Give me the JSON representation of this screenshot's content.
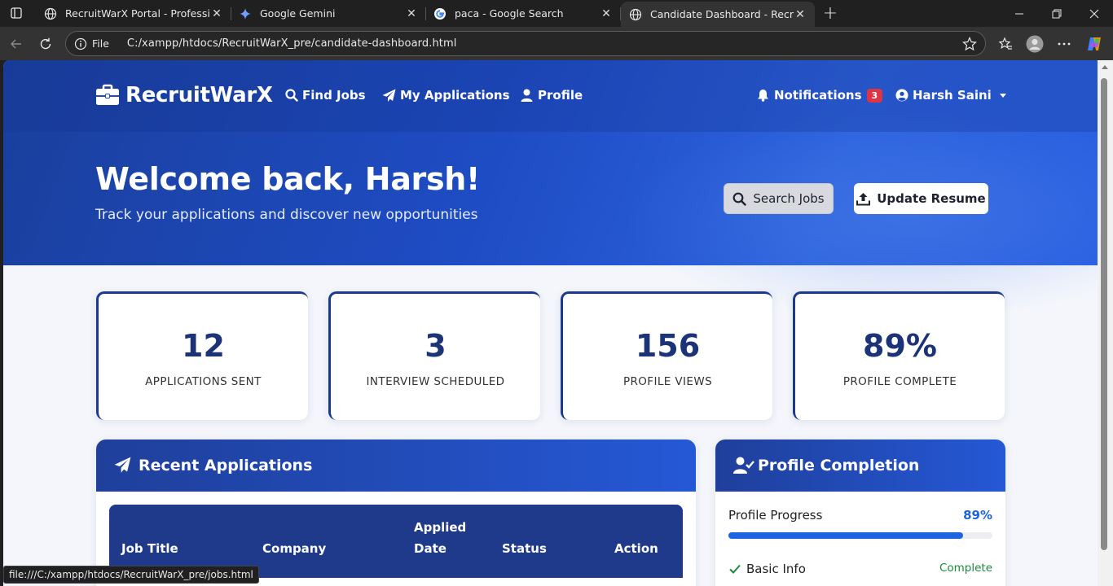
{
  "browser": {
    "tabs": [
      {
        "title": "RecruitWarX Portal - Professional",
        "icon": "globe-icon"
      },
      {
        "title": "Google Gemini",
        "icon": "gemini-icon"
      },
      {
        "title": "paca - Google Search",
        "icon": "google-icon"
      },
      {
        "title": "Candidate Dashboard - RecruitWa",
        "icon": "globe-icon",
        "active": true
      }
    ],
    "omnibox": {
      "scheme_label": "File",
      "url": "C:/xampp/htdocs/RecruitWarX_pre/candidate-dashboard.html"
    },
    "status_url": "file:///C:/xampp/htdocs/RecruitWarX_pre/jobs.html"
  },
  "nav": {
    "brand": "RecruitWarX",
    "links": {
      "find_jobs": "Find Jobs",
      "my_applications": "My Applications",
      "profile": "Profile"
    },
    "notifications_label": "Notifications",
    "notifications_count": "3",
    "user_name": "Harsh Saini"
  },
  "hero": {
    "title": "Welcome back, Harsh!",
    "subtitle": "Track your applications and discover new opportunities",
    "search_button": "Search Jobs",
    "resume_button": "Update Resume"
  },
  "stats": [
    {
      "value": "12",
      "label": "APPLICATIONS SENT"
    },
    {
      "value": "3",
      "label": "INTERVIEW SCHEDULED"
    },
    {
      "value": "156",
      "label": "PROFILE VIEWS"
    },
    {
      "value": "89%",
      "label": "PROFILE COMPLETE"
    }
  ],
  "recent_applications": {
    "title": "Recent Applications",
    "columns": {
      "job_title": "Job Title",
      "company": "Company",
      "applied_line1": "Applied",
      "applied_line2": "Date",
      "status": "Status",
      "action": "Action"
    }
  },
  "profile_completion": {
    "title": "Profile Completion",
    "progress_label": "Profile Progress",
    "progress_value": "89%",
    "progress_fraction": 0.89,
    "items": [
      {
        "label": "Basic Info",
        "status": "Complete"
      }
    ]
  },
  "colors": {
    "accent": "#1e63e0",
    "hero_dark": "#1a3f9c",
    "stat_value": "#1c3477",
    "badge": "#dc3545",
    "complete": "#1b8a3a"
  }
}
